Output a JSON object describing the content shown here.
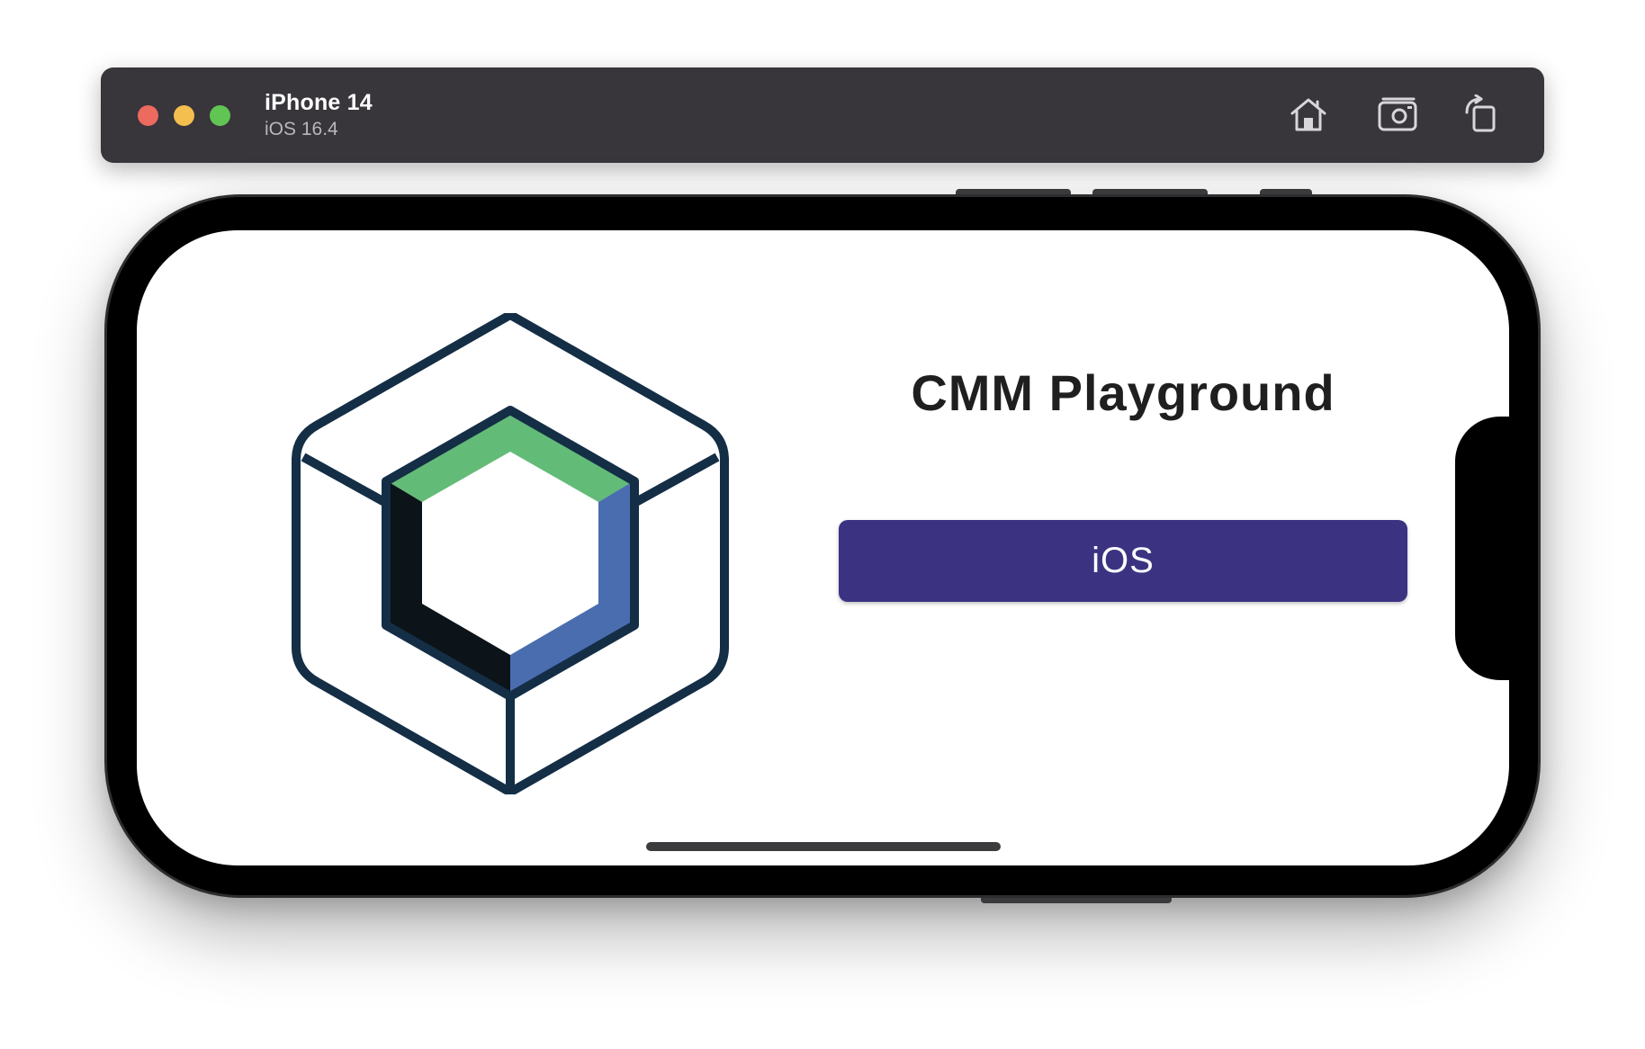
{
  "toolbar": {
    "device_name": "iPhone 14",
    "os_version": "iOS 16.4",
    "icons": [
      "home-icon",
      "screenshot-icon",
      "rotate-icon"
    ]
  },
  "window_controls": {
    "close_color": "#ec6a5e",
    "minimize_color": "#f4bf4f",
    "maximize_color": "#61c554"
  },
  "app": {
    "title": "CMM Playground",
    "platform_button_label": "iOS",
    "button_color": "#3b3382",
    "logo_colors": {
      "outline": "#142e46",
      "top": "#63bb78",
      "right": "#4a6daf",
      "left": "#0c1419"
    }
  }
}
